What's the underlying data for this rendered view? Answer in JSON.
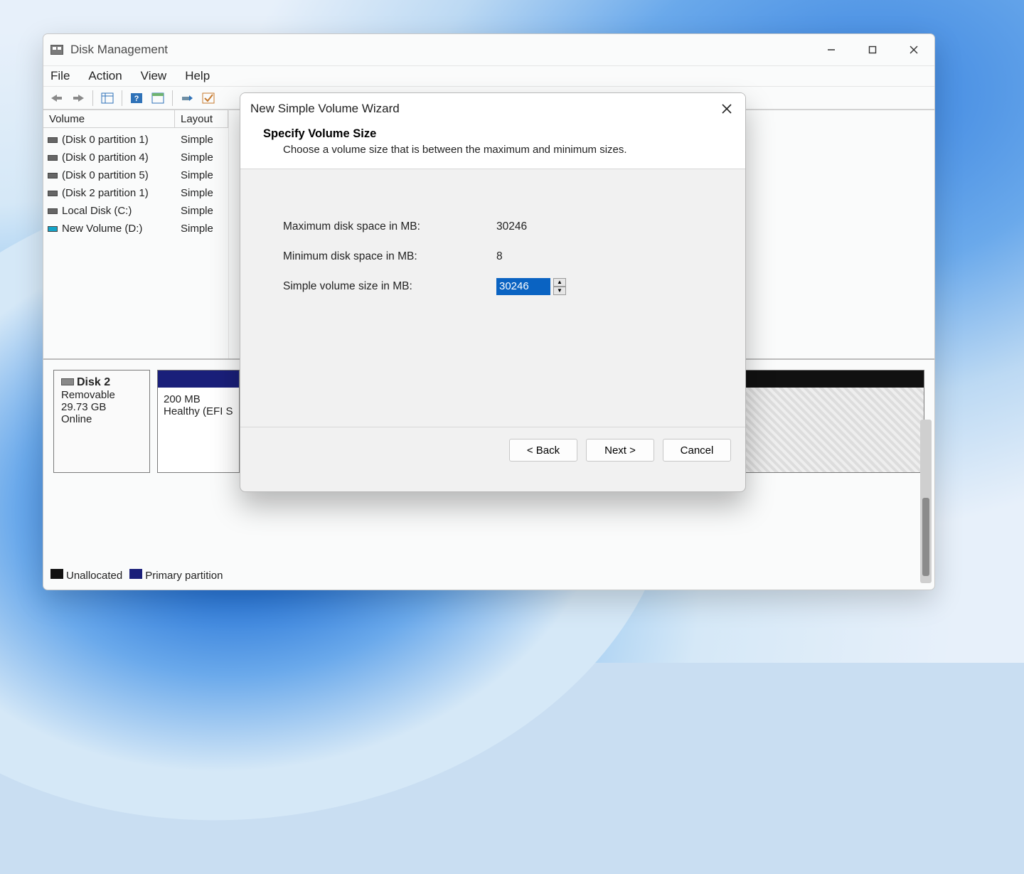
{
  "app": {
    "title": "Disk Management"
  },
  "menu": {
    "file": "File",
    "action": "Action",
    "view": "View",
    "help": "Help"
  },
  "table": {
    "headers": {
      "volume": "Volume",
      "layout": "Layout"
    },
    "rows": [
      {
        "name": "(Disk 0 partition 1)",
        "layout": "Simple",
        "accent": false
      },
      {
        "name": "(Disk 0 partition 4)",
        "layout": "Simple",
        "accent": false
      },
      {
        "name": "(Disk 0 partition 5)",
        "layout": "Simple",
        "accent": false
      },
      {
        "name": "(Disk 2 partition 1)",
        "layout": "Simple",
        "accent": false
      },
      {
        "name": "Local Disk (C:)",
        "layout": "Simple",
        "accent": false
      },
      {
        "name": "New Volume (D:)",
        "layout": "Simple",
        "accent": true
      }
    ]
  },
  "disk": {
    "label": "Disk 2",
    "type": "Removable",
    "size": "29.73 GB",
    "status": "Online",
    "seg1_size": "200 MB",
    "seg1_status": "Healthy (EFI S"
  },
  "legend": {
    "unallocated": "Unallocated",
    "primary": "Primary partition"
  },
  "wizard": {
    "title": "New Simple Volume Wizard",
    "heading": "Specify Volume Size",
    "sub": "Choose a volume size that is between the maximum and minimum sizes.",
    "max_label": "Maximum disk space in MB:",
    "max_value": "30246",
    "min_label": "Minimum disk space in MB:",
    "min_value": "8",
    "size_label": "Simple volume size in MB:",
    "size_value": "30246",
    "back": "< Back",
    "next": "Next >",
    "cancel": "Cancel"
  }
}
